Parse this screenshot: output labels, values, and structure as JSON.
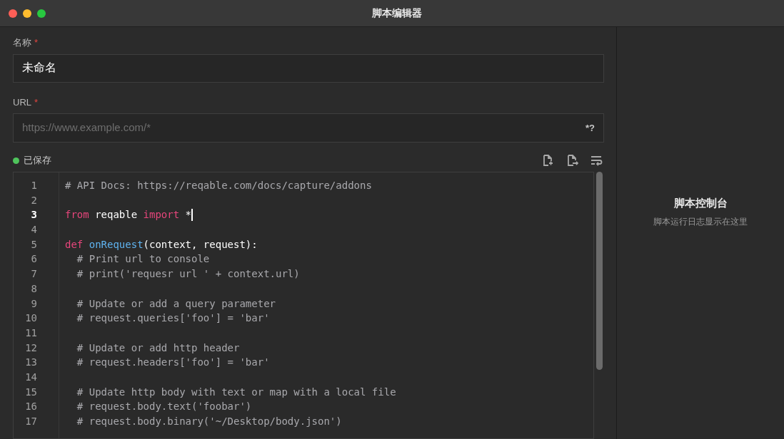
{
  "window": {
    "title": "脚本编辑器"
  },
  "name_field": {
    "label": "名称",
    "required_mark": "*",
    "value": "未命名"
  },
  "url_field": {
    "label": "URL",
    "required_mark": "*",
    "placeholder": "https://www.example.com/*",
    "suffix": "*?"
  },
  "status": {
    "text": "已保存",
    "saved": true
  },
  "editor": {
    "lines": [
      {
        "number": "1",
        "current": false,
        "tokens": [
          {
            "kind": "comment",
            "text": "# API Docs: https://reqable.com/docs/capture/addons"
          }
        ]
      },
      {
        "number": "2",
        "current": false
      },
      {
        "number": "3",
        "current": true,
        "tokens": [
          {
            "kind": "keyword",
            "text": "from"
          },
          {
            "kind": "plain",
            "text": " reqable "
          },
          {
            "kind": "keyword",
            "text": "import"
          },
          {
            "kind": "plain",
            "text": " *"
          }
        ]
      },
      {
        "number": "4",
        "current": false
      },
      {
        "number": "5",
        "current": false,
        "tokens": [
          {
            "kind": "keyword",
            "text": "def "
          },
          {
            "kind": "function",
            "text": "onRequest"
          },
          {
            "kind": "plain",
            "text": "(context, request):"
          }
        ]
      },
      {
        "number": "6",
        "current": false,
        "tokens": [
          {
            "kind": "comment",
            "text": "  # Print url to console"
          }
        ]
      },
      {
        "number": "7",
        "current": false,
        "tokens": [
          {
            "kind": "comment",
            "text": "  # print('requesr url ' + context.url)"
          }
        ]
      },
      {
        "number": "8",
        "current": false
      },
      {
        "number": "9",
        "current": false,
        "tokens": [
          {
            "kind": "comment",
            "text": "  # Update or add a query parameter"
          }
        ]
      },
      {
        "number": "10",
        "current": false,
        "tokens": [
          {
            "kind": "comment",
            "text": "  # request.queries['foo'] = 'bar'"
          }
        ]
      },
      {
        "number": "11",
        "current": false
      },
      {
        "number": "12",
        "current": false,
        "tokens": [
          {
            "kind": "comment",
            "text": "  # Update or add http header"
          }
        ]
      },
      {
        "number": "13",
        "current": false,
        "tokens": [
          {
            "kind": "comment",
            "text": "  # request.headers['foo'] = 'bar'"
          }
        ]
      },
      {
        "number": "14",
        "current": false
      },
      {
        "number": "15",
        "current": false,
        "tokens": [
          {
            "kind": "comment",
            "text": "  # Update http body with text or map with a local file"
          }
        ]
      },
      {
        "number": "16",
        "current": false,
        "tokens": [
          {
            "kind": "comment",
            "text": "  # request.body.text('foobar')"
          }
        ]
      },
      {
        "number": "17",
        "current": false,
        "tokens": [
          {
            "kind": "comment",
            "text": "  # request.body.binary('~/Desktop/body.json')"
          }
        ]
      }
    ]
  },
  "console": {
    "title": "脚本控制台",
    "subtitle": "脚本运行日志显示在这里"
  }
}
